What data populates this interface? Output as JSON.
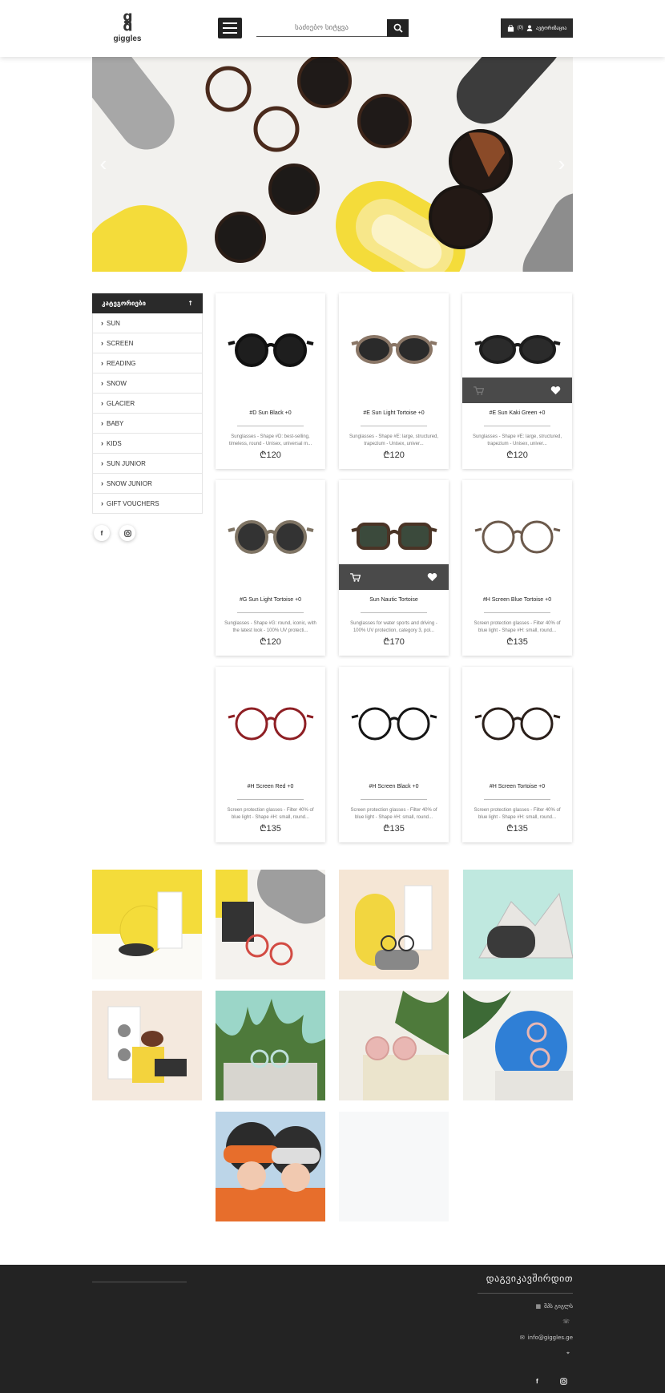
{
  "header": {
    "logo_mark": "g",
    "logo_text": "giggles",
    "search": {
      "placeholder": "საძიებო სიტყვა"
    },
    "cart_count": "(0)",
    "login_label": "ავტორიზაცია"
  },
  "sidebar": {
    "title": "კატეგორიები",
    "items": [
      {
        "label": "SUN"
      },
      {
        "label": "SCREEN"
      },
      {
        "label": "READING"
      },
      {
        "label": "SNOW"
      },
      {
        "label": "GLACIER"
      },
      {
        "label": "BABY"
      },
      {
        "label": "KIDS"
      },
      {
        "label": "SUN JUNIOR"
      },
      {
        "label": "SNOW JUNIOR"
      },
      {
        "label": "GIFT VOUCHERS"
      }
    ],
    "socials": [
      "f",
      "instagram-icon"
    ]
  },
  "products": [
    {
      "title": "#D Sun Black +0",
      "desc": "Sunglasses - Shape #D: best-selling, timeless, round - Unisex, universal m...",
      "price": "₾120",
      "frame": "#111111",
      "lens": "#1e1e1e",
      "style": "round",
      "hover": false
    },
    {
      "title": "#E Sun Light Tortoise +0",
      "desc": "Sunglasses - Shape #E: large, structured, trapezium - Unisex, univer...",
      "price": "₾120",
      "frame": "#8a7666",
      "lens": "#2a2a2a",
      "style": "wide",
      "hover": false
    },
    {
      "title": "#E Sun Kaki Green +0",
      "desc": "Sunglasses - Shape #E: large, structured, trapezium - Unisex, univer...",
      "price": "₾120",
      "frame": "#1d1d1d",
      "lens": "#2b2b2b",
      "style": "wide",
      "hover": true
    },
    {
      "title": "#G Sun Light Tortoise +0",
      "desc": "Sunglasses - Shape #G: round, iconic, with the latest look - 100% UV protecti...",
      "price": "₾120",
      "frame": "#7f7464",
      "lens": "#333333",
      "style": "round",
      "hover": false
    },
    {
      "title": "Sun Nautic Tortoise",
      "desc": "Sunglasses for water sports and driving - 100% UV protection, category 3, pol...",
      "price": "₾170",
      "frame": "#4a3426",
      "lens": "#3b4a3c",
      "style": "square",
      "hover": true
    },
    {
      "title": "#H Screen Blue Tortoise +0",
      "desc": "Screen protection glasses - Filter 40% of blue light - Shape #H: small, round...",
      "price": "₾135",
      "frame": "#6c5a4c",
      "lens": "none",
      "style": "thin",
      "hover": false
    },
    {
      "title": "#H Screen Red +0",
      "desc": "Screen protection glasses - Filter 40% of blue light - Shape #H: small, round...",
      "price": "₾135",
      "frame": "#8e1f24",
      "lens": "none",
      "style": "thin",
      "hover": false
    },
    {
      "title": "#H Screen Black +0",
      "desc": "Screen protection glasses - Filter 40% of blue light - Shape #H: small, round...",
      "price": "₾135",
      "frame": "#151515",
      "lens": "none",
      "style": "thin",
      "hover": false
    },
    {
      "title": "#H Screen Tortoise +0",
      "desc": "Screen protection glasses - Filter 40% of blue light - Shape #H: small, round...",
      "price": "₾135",
      "frame": "#2a1f1a",
      "lens": "none",
      "style": "thin",
      "hover": false
    }
  ],
  "gallery": [
    {
      "name": "gallery-yellow-pedestal",
      "bg": "#f1e8d6",
      "accent": "#f4dc3a"
    },
    {
      "name": "gallery-red-glasses",
      "bg": "#f4f2ee",
      "accent": "#d24b43"
    },
    {
      "name": "gallery-yellow-arch",
      "bg": "#f5e6d5",
      "accent": "#f2d640"
    },
    {
      "name": "gallery-mint-goggles",
      "bg": "#bfe8df",
      "accent": "#3a3a3a"
    },
    {
      "name": "gallery-cream-box",
      "bg": "#f4e9de",
      "accent": "#f3d33d"
    },
    {
      "name": "gallery-palm-teal",
      "bg": "#9bd6c8",
      "accent": "#4e7a3b"
    },
    {
      "name": "gallery-pink-kids",
      "bg": "#f0ede6",
      "accent": "#e9b7b3"
    },
    {
      "name": "gallery-blue-cylinder",
      "bg": "#f2f1ec",
      "accent": "#2f7fd6"
    },
    {
      "name": "gallery-ski-kids",
      "bg": "#bcd5e8",
      "accent": "#e76e2c"
    },
    {
      "name": "gallery-empty",
      "bg": "#f7f8f9",
      "accent": "#f7f8f9"
    }
  ],
  "footer": {
    "title": "დაგვიკავშირდით",
    "address": "შპს გიგლს",
    "phone": "",
    "email": "info@giggles.ge",
    "location": ""
  },
  "colors": {
    "dark": "#2a2a2a",
    "footer": "#232323",
    "accent_yellow": "#f4dc3a"
  }
}
